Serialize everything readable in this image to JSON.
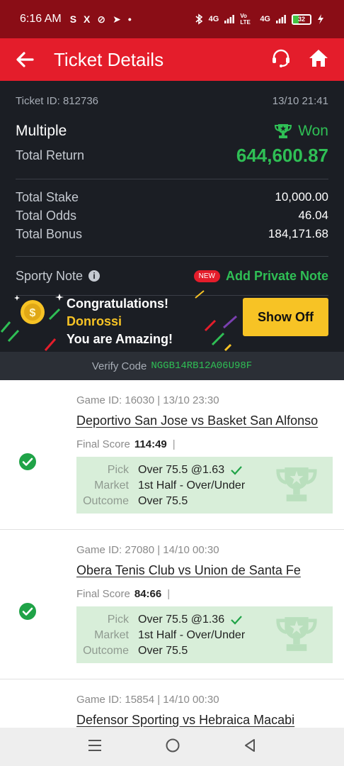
{
  "status_bar": {
    "time": "6:16 AM",
    "notif_icons": [
      "S",
      "X",
      "⊘",
      "➤",
      "•"
    ],
    "network_1": "4G",
    "volte": "Vo LTE",
    "network_2": "4G",
    "battery_level": 32,
    "battery_text": "32"
  },
  "header": {
    "title": "Ticket Details"
  },
  "ticket": {
    "id_text": "Ticket ID: 812736",
    "date": "13/10 21:41",
    "type": "Multiple",
    "status": "Won",
    "total_return_label": "Total Return",
    "total_return": "644,600.87",
    "stats": [
      {
        "label": "Total Stake",
        "value": "10,000.00"
      },
      {
        "label": "Total Odds",
        "value": "46.04"
      },
      {
        "label": "Total Bonus",
        "value": "184,171.68"
      }
    ],
    "note_label": "Sporty Note",
    "new_badge": "NEW",
    "add_note": "Add Private Note"
  },
  "banner": {
    "line1": "Congratulations!",
    "name": "Donrossi",
    "line3": "You are Amazing!",
    "button": "Show Off"
  },
  "verify": {
    "label": "Verify Code",
    "code": "NGGB14RB12A06U98F"
  },
  "labels": {
    "final_score": "Final Score",
    "pick": "Pick",
    "market": "Market",
    "outcome": "Outcome"
  },
  "games": [
    {
      "meta": "Game ID: 16030 | 13/10 23:30",
      "match": "Deportivo San Jose vs Basket San Alfonso",
      "score": "114:49",
      "pick": "Over 75.5 @1.63",
      "market": "1st Half - Over/Under",
      "outcome": "Over 75.5"
    },
    {
      "meta": "Game ID: 27080 | 14/10 00:30",
      "match": "Obera Tenis Club vs Union de Santa Fe",
      "score": "84:66",
      "pick": "Over 75.5 @1.36",
      "market": "1st Half - Over/Under",
      "outcome": "Over 75.5"
    },
    {
      "meta": "Game ID: 15854 | 14/10 00:30",
      "match": "Defensor Sporting vs Hebraica Macabi"
    }
  ],
  "colors": {
    "brand_red": "#e41d2b",
    "status_red": "#8a0d16",
    "dark_bg": "#1b1e24",
    "win_green": "#2fbf55",
    "gold": "#f7c325",
    "pick_bg": "#d8eed9"
  }
}
